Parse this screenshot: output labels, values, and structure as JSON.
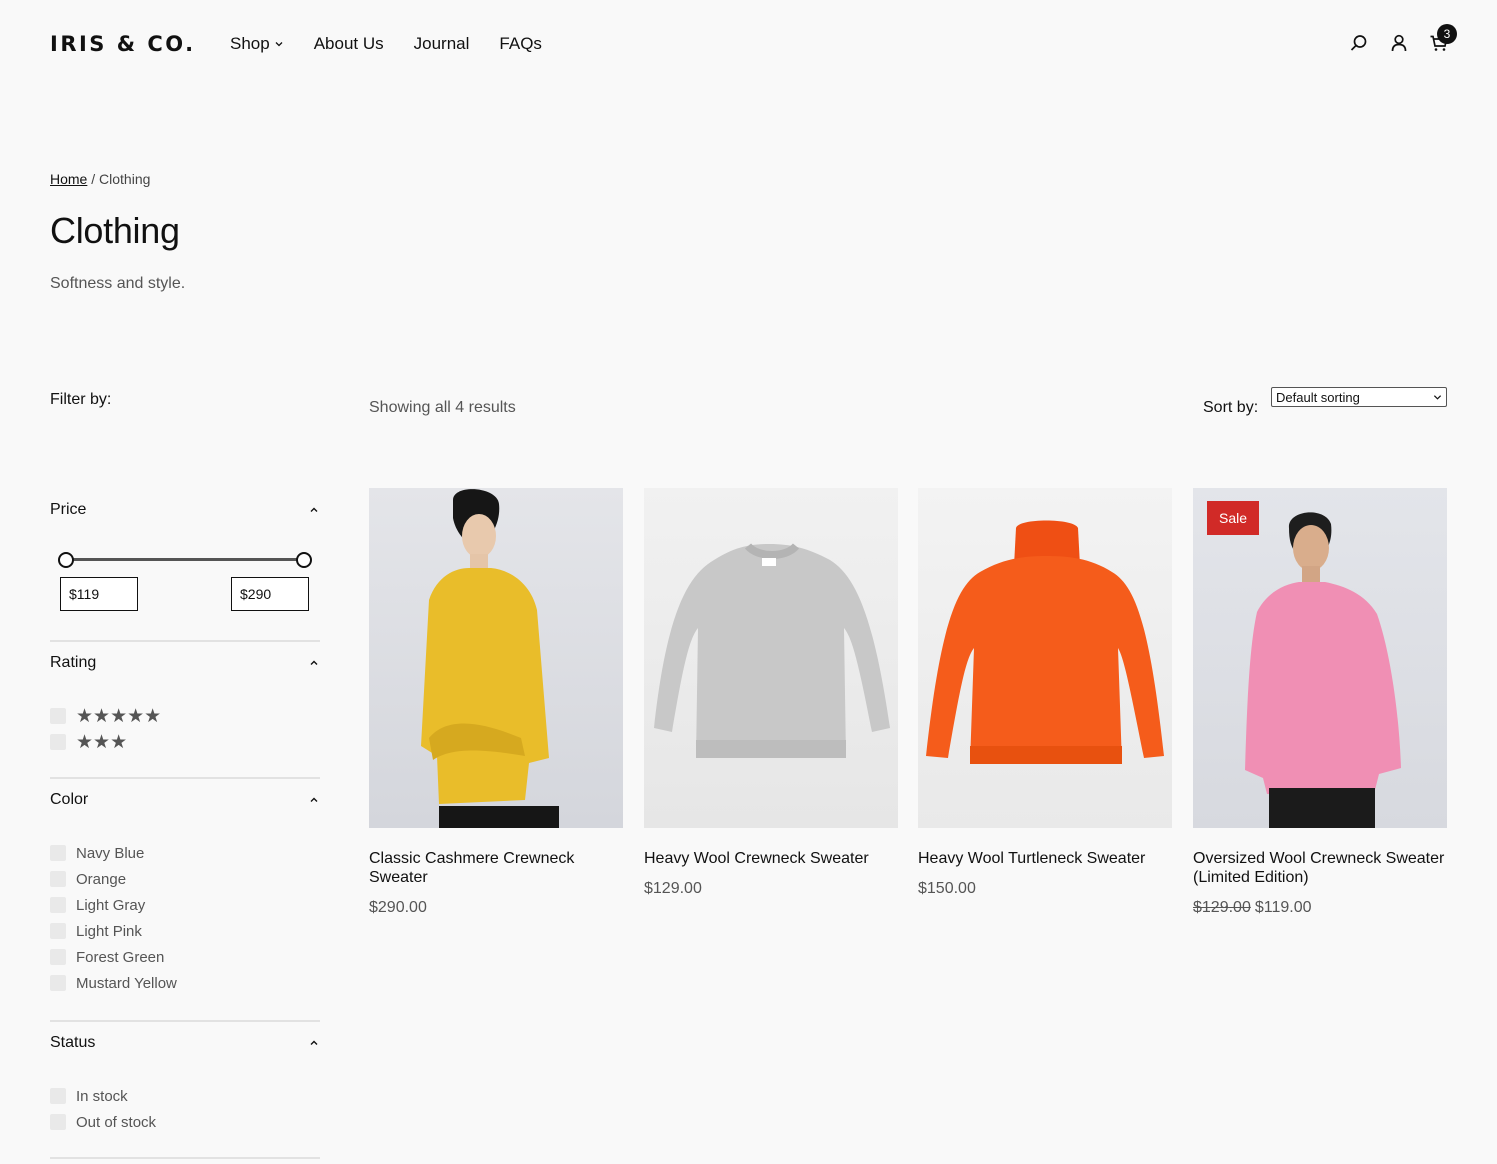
{
  "brand": {
    "logo": "IRIS & CO."
  },
  "nav": {
    "items": [
      {
        "label": "Shop"
      },
      {
        "label": "About Us"
      },
      {
        "label": "Journal"
      },
      {
        "label": "FAQs"
      }
    ]
  },
  "header_icons": {
    "search": "search-icon",
    "account": "user-icon",
    "cart": "cart-icon",
    "cart_count": "3"
  },
  "breadcrumb": {
    "home": "Home",
    "separator": "/",
    "current": "Clothing"
  },
  "page": {
    "title": "Clothing",
    "description": "Softness and style."
  },
  "filters": {
    "heading": "Filter by:",
    "price": {
      "label": "Price",
      "min": "$119",
      "max": "$290",
      "range_low_fraction": 0.0,
      "range_high_fraction": 1.0
    },
    "rating": {
      "label": "Rating",
      "options": [
        {
          "stars": 5,
          "glyphs": "★★★★★"
        },
        {
          "stars": 3,
          "glyphs": "★★★"
        }
      ]
    },
    "color": {
      "label": "Color",
      "options": [
        "Navy Blue",
        "Orange",
        "Light Gray",
        "Light Pink",
        "Forest Green",
        "Mustard Yellow"
      ]
    },
    "status": {
      "label": "Status",
      "options": [
        "In stock",
        "Out of stock"
      ]
    }
  },
  "toolbar": {
    "result_count": "Showing all 4 results",
    "sort_label": "Sort by:",
    "sort_value": "Default sorting"
  },
  "products": [
    {
      "name": "Classic Cashmere Crewneck Sweater",
      "price": "$290.00",
      "old_price": "",
      "sale": false,
      "color": "#e8c12a"
    },
    {
      "name": "Heavy Wool Crewneck Sweater",
      "price": "$129.00",
      "old_price": "",
      "sale": false,
      "color": "#c6c6c6"
    },
    {
      "name": "Heavy Wool Turtleneck Sweater",
      "price": "$150.00",
      "old_price": "",
      "sale": false,
      "color": "#f4581c"
    },
    {
      "name": "Oversized Wool Crewneck Sweater (Limited Edition)",
      "price": "$119.00",
      "old_price": "$129.00",
      "sale": true,
      "sale_label": "Sale",
      "color": "#ec8fb3"
    }
  ]
}
